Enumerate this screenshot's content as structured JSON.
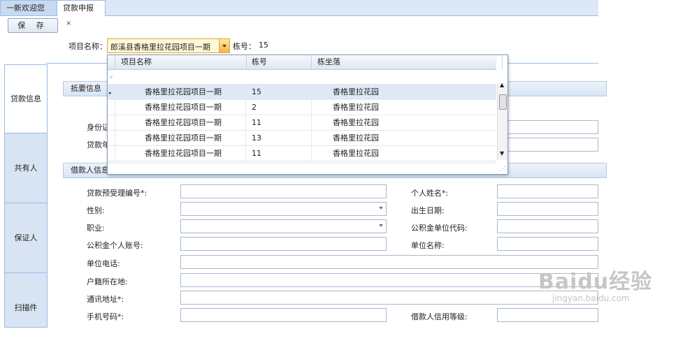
{
  "tabs": {
    "welcome": "一新欢迎您",
    "loan": "贷款申报",
    "close": "×"
  },
  "toolbar": {
    "save": "保 存"
  },
  "project": {
    "label": "项目名称：",
    "value": "郎溪县香格里拉花园项目一期",
    "building_label": "栋号：",
    "building_value": "15"
  },
  "vtabs": [
    "贷款信息",
    "共有人",
    "保证人",
    "扫描件"
  ],
  "dropdown": {
    "headers": [
      "项目名称",
      "栋号",
      "栋坐落"
    ],
    "rows": [
      {
        "name": "香格里拉花园项目一期",
        "no": "15",
        "loc": "香格里拉花园"
      },
      {
        "name": "香格里拉花园项目一期",
        "no": "2",
        "loc": "香格里拉花园"
      },
      {
        "name": "香格里拉花园项目一期",
        "no": "11",
        "loc": "香格里拉花园"
      },
      {
        "name": "香格里拉花园项目一期",
        "no": "13",
        "loc": "香格里拉花园"
      },
      {
        "name": "香格里拉花园项目一期",
        "no": "11",
        "loc": "香格里拉花园"
      }
    ]
  },
  "sections": {
    "summary": "抵要信息",
    "borrower": "借款人信息"
  },
  "summary_fields": {
    "id": "身份证",
    "year": "贷款年"
  },
  "fields": {
    "preaccept": "贷款预受理编号*:",
    "gender": "性别:",
    "job": "职业:",
    "fund_account": "公积金个人账号:",
    "unit_phone": "单位电话:",
    "household": "户籍所在地:",
    "address": "通讯地址*:",
    "mobile": "手机号码*:",
    "name": "个人姓名*:",
    "birth": "出生日期:",
    "fund_unit": "公积金单位代码:",
    "unit_name": "单位名称:",
    "credit": "借款人信用等级:"
  },
  "watermark": {
    "logo": "Baidu经验",
    "url": "jingyan.baidu.com"
  }
}
